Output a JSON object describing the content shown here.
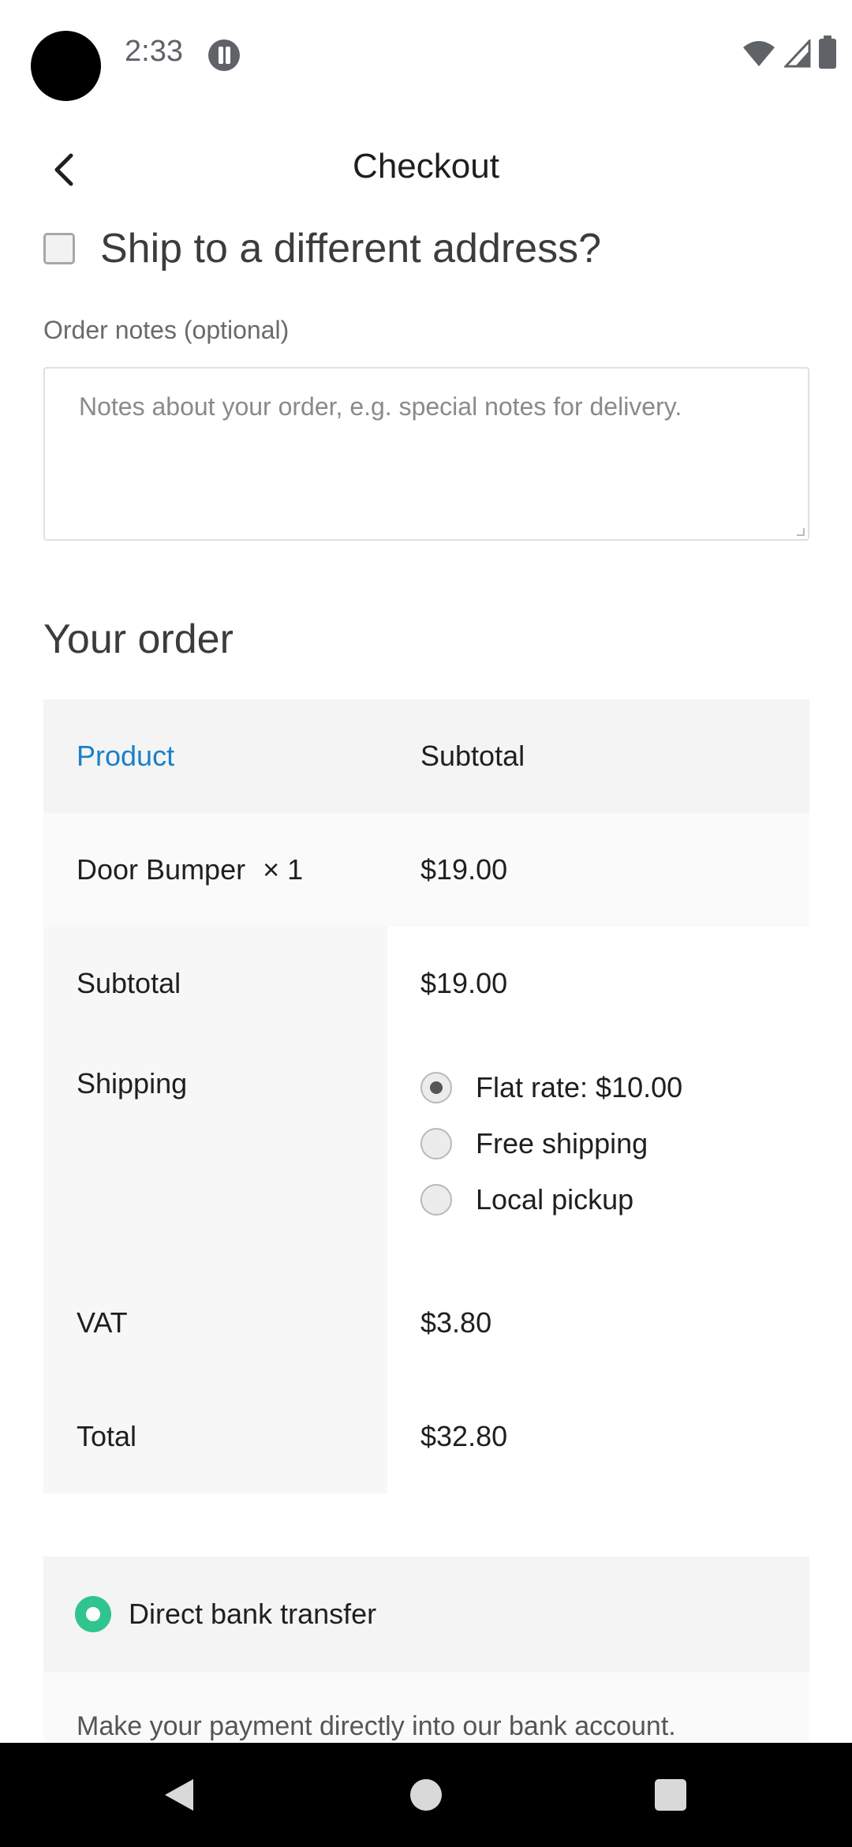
{
  "status_bar": {
    "time": "2:33",
    "icons": [
      "camera-cutout",
      "app-notification-icon",
      "wifi-icon",
      "signal-icon",
      "battery-icon"
    ]
  },
  "app_bar": {
    "title": "Checkout",
    "back_icon": "chevron-left-icon"
  },
  "shipping_checkbox": {
    "label": "Ship to a different address?",
    "checked": false
  },
  "order_notes": {
    "label": "Order notes (optional)",
    "placeholder": "Notes about your order, e.g. special notes for delivery.",
    "value": ""
  },
  "your_order": {
    "heading": "Your order",
    "header": {
      "product": "Product",
      "subtotal": "Subtotal"
    },
    "items": [
      {
        "name": "Door Bumper",
        "quantity": "× 1",
        "price": "$19.00"
      }
    ],
    "subtotal": {
      "label": "Subtotal",
      "value": "$19.00"
    },
    "shipping": {
      "label": "Shipping",
      "options": [
        {
          "label": "Flat rate: $10.00",
          "selected": true
        },
        {
          "label": "Free shipping",
          "selected": false
        },
        {
          "label": "Local pickup",
          "selected": false
        }
      ]
    },
    "vat": {
      "label": "VAT",
      "value": "$3.80"
    },
    "total": {
      "label": "Total",
      "value": "$32.80"
    }
  },
  "payment": {
    "method_label": "Direct bank transfer",
    "selected": true,
    "description": "Make your payment directly into our bank account."
  },
  "colors": {
    "accent_link": "#1a80c9",
    "payment_radio": "#2fc58c"
  }
}
